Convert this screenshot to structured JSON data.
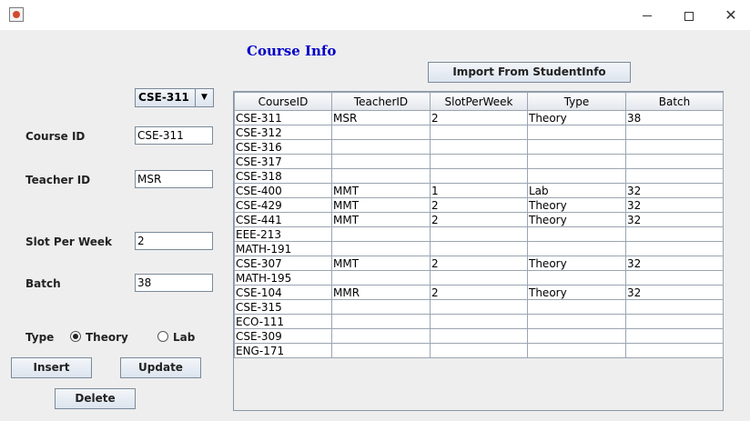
{
  "window": {
    "close_symbol": "✕"
  },
  "header": {
    "title": "Course Info"
  },
  "import_button_label": "Import From StudentInfo",
  "course_select": {
    "selected": "CSE-311"
  },
  "form": {
    "course_id_label": "Course ID",
    "course_id_value": "CSE-311",
    "teacher_id_label": "Teacher ID",
    "teacher_id_value": "MSR",
    "slot_label": "Slot Per Week",
    "slot_value": "2",
    "batch_label": "Batch",
    "batch_value": "38",
    "type_label": "Type",
    "type_options": [
      "Theory",
      "Lab"
    ],
    "type_selected": "Theory"
  },
  "buttons": {
    "insert": "Insert",
    "update": "Update",
    "delete": "Delete"
  },
  "table": {
    "columns": [
      "CourseID",
      "TeacherID",
      "SlotPerWeek",
      "Type",
      "Batch"
    ],
    "rows": [
      [
        "CSE-311",
        "MSR",
        "2",
        "Theory",
        "38"
      ],
      [
        "CSE-312",
        "",
        "",
        "",
        ""
      ],
      [
        "CSE-316",
        "",
        "",
        "",
        ""
      ],
      [
        "CSE-317",
        "",
        "",
        "",
        ""
      ],
      [
        "CSE-318",
        "",
        "",
        "",
        ""
      ],
      [
        "CSE-400",
        "MMT",
        "1",
        "Lab",
        "32"
      ],
      [
        "CSE-429",
        "MMT",
        "2",
        "Theory",
        "32"
      ],
      [
        "CSE-441",
        "MMT",
        "2",
        "Theory",
        "32"
      ],
      [
        "EEE-213",
        "",
        "",
        "",
        ""
      ],
      [
        "MATH-191",
        "",
        "",
        "",
        ""
      ],
      [
        "CSE-307",
        "MMT",
        "2",
        "Theory",
        "32"
      ],
      [
        "MATH-195",
        "",
        "",
        "",
        ""
      ],
      [
        "CSE-104",
        "MMR",
        "2",
        "Theory",
        "32"
      ],
      [
        "CSE-315",
        "",
        "",
        "",
        ""
      ],
      [
        "ECO-111",
        "",
        "",
        "",
        ""
      ],
      [
        "CSE-309",
        "",
        "",
        "",
        ""
      ],
      [
        "ENG-171",
        "",
        "",
        "",
        ""
      ]
    ]
  }
}
